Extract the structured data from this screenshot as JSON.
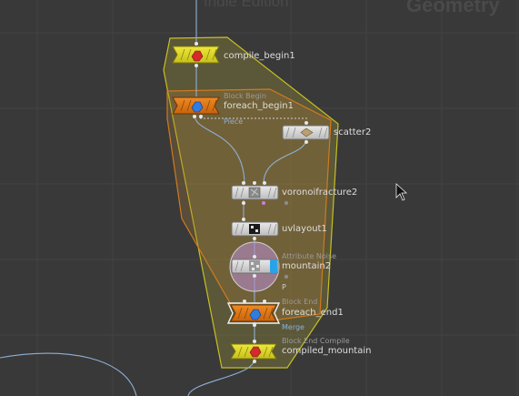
{
  "watermark": {
    "edition": "Indie Edition",
    "context": "Geometry"
  },
  "colors": {
    "background": "#393939",
    "grid": "#434343",
    "wire": "#8fb0d4",
    "compile_node": "#e4dd1e",
    "foreach_node": "#e0720f",
    "network_box_border": "#c8c020",
    "loop_box_border": "#d07a1e",
    "generator_node": "#d9d9d9",
    "param_highlight": "#b58bc8",
    "display_flag": "#29a3e8",
    "port": "#e6e6e6",
    "port_attr": "#d07fd0"
  },
  "nodes": [
    {
      "id": "compile_begin1",
      "name": "compile_begin1",
      "type_label": "",
      "kind": "compile",
      "icon": "compile-icon"
    },
    {
      "id": "foreach_begin1",
      "name": "foreach_begin1",
      "type_label": "Block Begin",
      "kind": "foreach",
      "icon": "foreach-icon"
    },
    {
      "id": "scatter2",
      "name": "scatter2",
      "type_label": "",
      "kind": "generator",
      "icon": "scatter-icon"
    },
    {
      "id": "voronoifracture2",
      "name": "voronoifracture2",
      "type_label": "",
      "kind": "generator",
      "icon": "voronoi-icon"
    },
    {
      "id": "uvlayout1",
      "name": "uvlayout1",
      "type_label": "",
      "kind": "generator",
      "icon": "uvlayout-icon"
    },
    {
      "id": "mountain2",
      "name": "mountain2",
      "type_label": "Attribute Noise",
      "kind": "generator",
      "icon": "noise-icon",
      "flag_text": "P",
      "display_flag": true,
      "highlighted": true
    },
    {
      "id": "foreach_end1",
      "name": "foreach_end1",
      "type_label": "Block End",
      "kind": "foreach",
      "icon": "foreach-icon",
      "selected": true
    },
    {
      "id": "compiled_mountain",
      "name": "compiled_mountain",
      "type_label": "Block End Compile",
      "kind": "compile",
      "icon": "compile-icon"
    }
  ],
  "wire_labels": {
    "piece": "Piece",
    "merge": "Merge"
  }
}
